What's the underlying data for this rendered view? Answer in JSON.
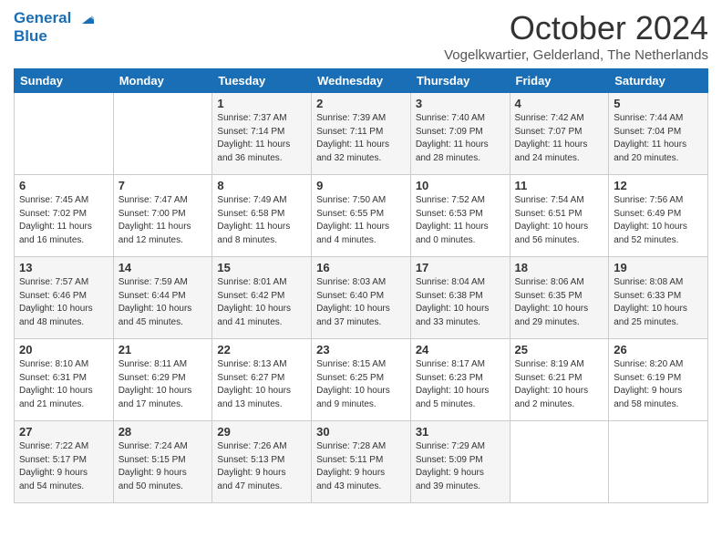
{
  "header": {
    "logo_line1": "General",
    "logo_line2": "Blue",
    "month": "October 2024",
    "location": "Vogelkwartier, Gelderland, The Netherlands"
  },
  "days_of_week": [
    "Sunday",
    "Monday",
    "Tuesday",
    "Wednesday",
    "Thursday",
    "Friday",
    "Saturday"
  ],
  "weeks": [
    [
      {
        "day": "",
        "info": ""
      },
      {
        "day": "",
        "info": ""
      },
      {
        "day": "1",
        "info": "Sunrise: 7:37 AM\nSunset: 7:14 PM\nDaylight: 11 hours\nand 36 minutes."
      },
      {
        "day": "2",
        "info": "Sunrise: 7:39 AM\nSunset: 7:11 PM\nDaylight: 11 hours\nand 32 minutes."
      },
      {
        "day": "3",
        "info": "Sunrise: 7:40 AM\nSunset: 7:09 PM\nDaylight: 11 hours\nand 28 minutes."
      },
      {
        "day": "4",
        "info": "Sunrise: 7:42 AM\nSunset: 7:07 PM\nDaylight: 11 hours\nand 24 minutes."
      },
      {
        "day": "5",
        "info": "Sunrise: 7:44 AM\nSunset: 7:04 PM\nDaylight: 11 hours\nand 20 minutes."
      }
    ],
    [
      {
        "day": "6",
        "info": "Sunrise: 7:45 AM\nSunset: 7:02 PM\nDaylight: 11 hours\nand 16 minutes."
      },
      {
        "day": "7",
        "info": "Sunrise: 7:47 AM\nSunset: 7:00 PM\nDaylight: 11 hours\nand 12 minutes."
      },
      {
        "day": "8",
        "info": "Sunrise: 7:49 AM\nSunset: 6:58 PM\nDaylight: 11 hours\nand 8 minutes."
      },
      {
        "day": "9",
        "info": "Sunrise: 7:50 AM\nSunset: 6:55 PM\nDaylight: 11 hours\nand 4 minutes."
      },
      {
        "day": "10",
        "info": "Sunrise: 7:52 AM\nSunset: 6:53 PM\nDaylight: 11 hours\nand 0 minutes."
      },
      {
        "day": "11",
        "info": "Sunrise: 7:54 AM\nSunset: 6:51 PM\nDaylight: 10 hours\nand 56 minutes."
      },
      {
        "day": "12",
        "info": "Sunrise: 7:56 AM\nSunset: 6:49 PM\nDaylight: 10 hours\nand 52 minutes."
      }
    ],
    [
      {
        "day": "13",
        "info": "Sunrise: 7:57 AM\nSunset: 6:46 PM\nDaylight: 10 hours\nand 48 minutes."
      },
      {
        "day": "14",
        "info": "Sunrise: 7:59 AM\nSunset: 6:44 PM\nDaylight: 10 hours\nand 45 minutes."
      },
      {
        "day": "15",
        "info": "Sunrise: 8:01 AM\nSunset: 6:42 PM\nDaylight: 10 hours\nand 41 minutes."
      },
      {
        "day": "16",
        "info": "Sunrise: 8:03 AM\nSunset: 6:40 PM\nDaylight: 10 hours\nand 37 minutes."
      },
      {
        "day": "17",
        "info": "Sunrise: 8:04 AM\nSunset: 6:38 PM\nDaylight: 10 hours\nand 33 minutes."
      },
      {
        "day": "18",
        "info": "Sunrise: 8:06 AM\nSunset: 6:35 PM\nDaylight: 10 hours\nand 29 minutes."
      },
      {
        "day": "19",
        "info": "Sunrise: 8:08 AM\nSunset: 6:33 PM\nDaylight: 10 hours\nand 25 minutes."
      }
    ],
    [
      {
        "day": "20",
        "info": "Sunrise: 8:10 AM\nSunset: 6:31 PM\nDaylight: 10 hours\nand 21 minutes."
      },
      {
        "day": "21",
        "info": "Sunrise: 8:11 AM\nSunset: 6:29 PM\nDaylight: 10 hours\nand 17 minutes."
      },
      {
        "day": "22",
        "info": "Sunrise: 8:13 AM\nSunset: 6:27 PM\nDaylight: 10 hours\nand 13 minutes."
      },
      {
        "day": "23",
        "info": "Sunrise: 8:15 AM\nSunset: 6:25 PM\nDaylight: 10 hours\nand 9 minutes."
      },
      {
        "day": "24",
        "info": "Sunrise: 8:17 AM\nSunset: 6:23 PM\nDaylight: 10 hours\nand 5 minutes."
      },
      {
        "day": "25",
        "info": "Sunrise: 8:19 AM\nSunset: 6:21 PM\nDaylight: 10 hours\nand 2 minutes."
      },
      {
        "day": "26",
        "info": "Sunrise: 8:20 AM\nSunset: 6:19 PM\nDaylight: 9 hours\nand 58 minutes."
      }
    ],
    [
      {
        "day": "27",
        "info": "Sunrise: 7:22 AM\nSunset: 5:17 PM\nDaylight: 9 hours\nand 54 minutes."
      },
      {
        "day": "28",
        "info": "Sunrise: 7:24 AM\nSunset: 5:15 PM\nDaylight: 9 hours\nand 50 minutes."
      },
      {
        "day": "29",
        "info": "Sunrise: 7:26 AM\nSunset: 5:13 PM\nDaylight: 9 hours\nand 47 minutes."
      },
      {
        "day": "30",
        "info": "Sunrise: 7:28 AM\nSunset: 5:11 PM\nDaylight: 9 hours\nand 43 minutes."
      },
      {
        "day": "31",
        "info": "Sunrise: 7:29 AM\nSunset: 5:09 PM\nDaylight: 9 hours\nand 39 minutes."
      },
      {
        "day": "",
        "info": ""
      },
      {
        "day": "",
        "info": ""
      }
    ]
  ]
}
